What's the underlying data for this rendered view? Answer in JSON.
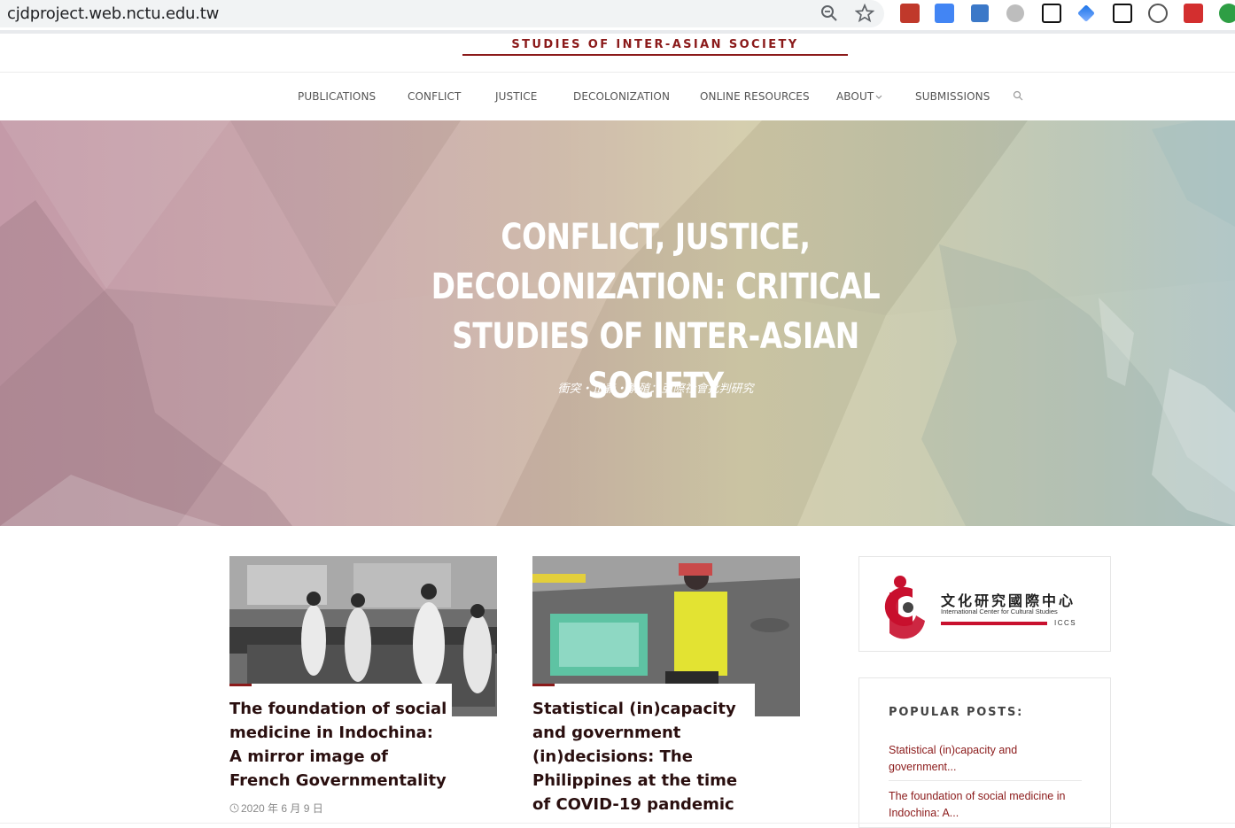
{
  "browser": {
    "url": "cjdproject.web.nctu.edu.tw",
    "icons": [
      "zoom-icon",
      "bookmark-star-icon",
      "pdf-extension-icon",
      "google-translate-icon",
      "translate-extension-icon",
      "globe-extension-icon",
      "notion-icon",
      "send-extension-icon",
      "notion-web-clipper-icon",
      "speech-extension-icon",
      "red-extension-icon",
      "green-extension-icon"
    ]
  },
  "site": {
    "title": "STUDIES OF INTER-ASIAN SOCIETY",
    "brand_color": "#8b1a1a"
  },
  "nav": {
    "items": [
      {
        "label": "PUBLICATIONS"
      },
      {
        "label": "CONFLICT"
      },
      {
        "label": "JUSTICE"
      },
      {
        "label": "DECOLONIZATION"
      },
      {
        "label": "ONLINE RESOURCES"
      },
      {
        "label": "ABOUT"
      },
      {
        "label": "SUBMISSIONS"
      }
    ],
    "search_icon": "search-icon"
  },
  "hero": {
    "title": "CONFLICT, JUSTICE, DECOLONIZATION: CRITICAL STUDIES OF INTER-ASIAN SOCIETY",
    "subtitle": "衝突・正義・解殖：亞際社會批判研究"
  },
  "posts": [
    {
      "title": "The foundation of social medicine in Indochina: A mirror image of French Governmentality",
      "date": "2020 年 6 月 9 日"
    },
    {
      "title": "Statistical (in)capacity and government (in)decisions: The Philippines at the time of COVID-19 pandemic"
    }
  ],
  "sidebar": {
    "iccs": {
      "chinese": "文化研究國際中心",
      "english": "International Center for Cultural Studies",
      "abbr": "ICCS"
    },
    "popular": {
      "title": "POPULAR POSTS:",
      "links": [
        "Statistical (in)capacity and government...",
        "The foundation of social medicine in Indochina: A..."
      ]
    }
  }
}
